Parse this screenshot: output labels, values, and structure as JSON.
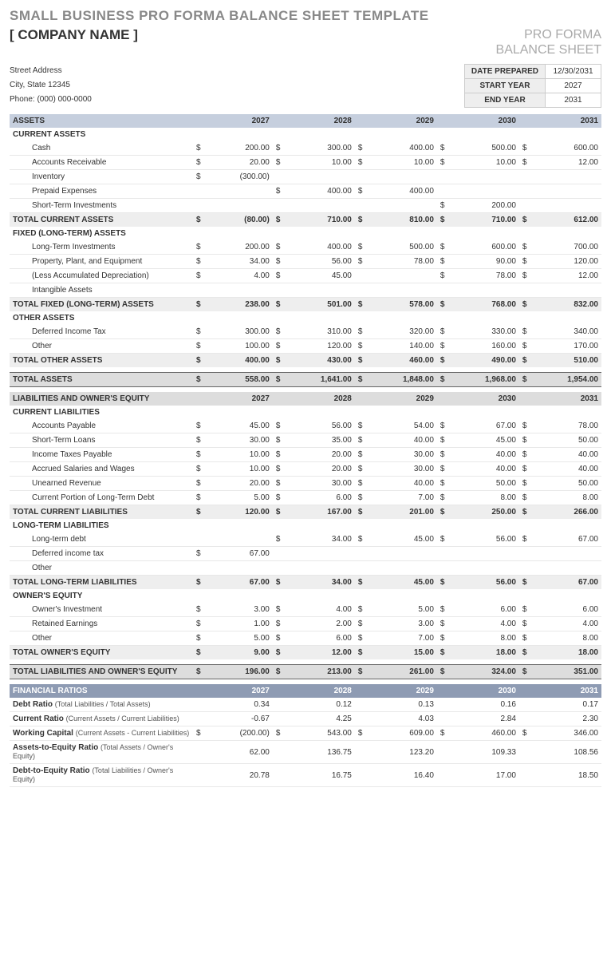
{
  "title": "SMALL BUSINESS PRO FORMA BALANCE SHEET TEMPLATE",
  "company_name": "[ COMPANY NAME ]",
  "proforma_line1": "PRO FORMA",
  "proforma_line2": "BALANCE SHEET",
  "address": {
    "street": "Street Address",
    "city": "City, State  12345",
    "phone": "Phone: (000) 000-0000"
  },
  "meta": {
    "date_prepared_label": "DATE PREPARED",
    "date_prepared": "12/30/2031",
    "start_year_label": "START YEAR",
    "start_year": "2027",
    "end_year_label": "END YEAR",
    "end_year": "2031"
  },
  "years": [
    "2027",
    "2028",
    "2029",
    "2030",
    "2031"
  ],
  "assets_header": "ASSETS",
  "current_assets_header": "CURRENT ASSETS",
  "current_assets": [
    {
      "label": "Cash",
      "v": [
        "200.00",
        "300.00",
        "400.00",
        "500.00",
        "600.00"
      ]
    },
    {
      "label": "Accounts Receivable",
      "v": [
        "20.00",
        "10.00",
        "10.00",
        "10.00",
        "12.00"
      ]
    },
    {
      "label": "Inventory",
      "v": [
        "(300.00)",
        "",
        "",
        "",
        ""
      ]
    },
    {
      "label": "Prepaid Expenses",
      "v": [
        "",
        "400.00",
        "400.00",
        "",
        ""
      ]
    },
    {
      "label": "Short-Term Investments",
      "v": [
        "",
        "",
        "",
        "200.00",
        ""
      ]
    }
  ],
  "total_current_assets": {
    "label": "TOTAL CURRENT ASSETS",
    "v": [
      "(80.00)",
      "710.00",
      "810.00",
      "710.00",
      "612.00"
    ]
  },
  "fixed_assets_header": "FIXED (LONG-TERM) ASSETS",
  "fixed_assets": [
    {
      "label": "Long-Term Investments",
      "v": [
        "200.00",
        "400.00",
        "500.00",
        "600.00",
        "700.00"
      ]
    },
    {
      "label": "Property, Plant, and Equipment",
      "v": [
        "34.00",
        "56.00",
        "78.00",
        "90.00",
        "120.00"
      ]
    },
    {
      "label": "(Less Accumulated Depreciation)",
      "v": [
        "4.00",
        "45.00",
        "",
        "78.00",
        "12.00"
      ]
    },
    {
      "label": "Intangible Assets",
      "v": [
        "",
        "",
        "",
        "",
        ""
      ]
    }
  ],
  "total_fixed_assets": {
    "label": "TOTAL FIXED (LONG-TERM) ASSETS",
    "v": [
      "238.00",
      "501.00",
      "578.00",
      "768.00",
      "832.00"
    ]
  },
  "other_assets_header": "OTHER ASSETS",
  "other_assets": [
    {
      "label": "Deferred Income Tax",
      "v": [
        "300.00",
        "310.00",
        "320.00",
        "330.00",
        "340.00"
      ]
    },
    {
      "label": "Other",
      "v": [
        "100.00",
        "120.00",
        "140.00",
        "160.00",
        "170.00"
      ]
    }
  ],
  "total_other_assets": {
    "label": "TOTAL OTHER ASSETS",
    "v": [
      "400.00",
      "430.00",
      "460.00",
      "490.00",
      "510.00"
    ]
  },
  "total_assets": {
    "label": "TOTAL ASSETS",
    "v": [
      "558.00",
      "1,641.00",
      "1,848.00",
      "1,968.00",
      "1,954.00"
    ]
  },
  "liab_header": "LIABILITIES AND OWNER'S EQUITY",
  "current_liab_header": "CURRENT LIABILITIES",
  "current_liab": [
    {
      "label": "Accounts Payable",
      "v": [
        "45.00",
        "56.00",
        "54.00",
        "67.00",
        "78.00"
      ]
    },
    {
      "label": "Short-Term Loans",
      "v": [
        "30.00",
        "35.00",
        "40.00",
        "45.00",
        "50.00"
      ]
    },
    {
      "label": "Income Taxes Payable",
      "v": [
        "10.00",
        "20.00",
        "30.00",
        "40.00",
        "40.00"
      ]
    },
    {
      "label": "Accrued Salaries and Wages",
      "v": [
        "10.00",
        "20.00",
        "30.00",
        "40.00",
        "40.00"
      ]
    },
    {
      "label": "Unearned Revenue",
      "v": [
        "20.00",
        "30.00",
        "40.00",
        "50.00",
        "50.00"
      ]
    },
    {
      "label": "Current Portion of Long-Term Debt",
      "v": [
        "5.00",
        "6.00",
        "7.00",
        "8.00",
        "8.00"
      ]
    }
  ],
  "total_current_liab": {
    "label": "TOTAL CURRENT LIABILITIES",
    "v": [
      "120.00",
      "167.00",
      "201.00",
      "250.00",
      "266.00"
    ]
  },
  "longterm_liab_header": "LONG-TERM LIABILITIES",
  "longterm_liab": [
    {
      "label": "Long-term debt",
      "v": [
        "",
        "34.00",
        "45.00",
        "56.00",
        "67.00"
      ]
    },
    {
      "label": "Deferred income tax",
      "v": [
        "67.00",
        "",
        "",
        "",
        ""
      ]
    },
    {
      "label": "Other",
      "v": [
        "",
        "",
        "",
        "",
        ""
      ]
    }
  ],
  "total_longterm_liab": {
    "label": "TOTAL LONG-TERM LIABILITIES",
    "v": [
      "67.00",
      "34.00",
      "45.00",
      "56.00",
      "67.00"
    ]
  },
  "equity_header": "OWNER'S EQUITY",
  "equity": [
    {
      "label": "Owner's Investment",
      "v": [
        "3.00",
        "4.00",
        "5.00",
        "6.00",
        "6.00"
      ]
    },
    {
      "label": "Retained Earnings",
      "v": [
        "1.00",
        "2.00",
        "3.00",
        "4.00",
        "4.00"
      ]
    },
    {
      "label": "Other",
      "v": [
        "5.00",
        "6.00",
        "7.00",
        "8.00",
        "8.00"
      ]
    }
  ],
  "total_equity": {
    "label": "TOTAL OWNER'S EQUITY",
    "v": [
      "9.00",
      "12.00",
      "15.00",
      "18.00",
      "18.00"
    ]
  },
  "total_liab_equity": {
    "label": "TOTAL LIABILITIES AND OWNER'S EQUITY",
    "v": [
      "196.00",
      "213.00",
      "261.00",
      "324.00",
      "351.00"
    ]
  },
  "fin_header": "FINANCIAL RATIOS",
  "fin_ratios": [
    {
      "label": "Debt Ratio",
      "sub": "(Total Liabilities / Total Assets)",
      "cur": false,
      "v": [
        "0.34",
        "0.12",
        "0.13",
        "0.16",
        "0.17"
      ]
    },
    {
      "label": "Current Ratio",
      "sub": "(Current Assets / Current Liabilities)",
      "cur": false,
      "v": [
        "-0.67",
        "4.25",
        "4.03",
        "2.84",
        "2.30"
      ]
    },
    {
      "label": "Working Capital",
      "sub": "(Current Assets - Current Liabilities)",
      "cur": true,
      "v": [
        "(200.00)",
        "543.00",
        "609.00",
        "460.00",
        "346.00"
      ]
    },
    {
      "label": "Assets-to-Equity Ratio",
      "sub": "(Total Assets / Owner's Equity)",
      "cur": false,
      "v": [
        "62.00",
        "136.75",
        "123.20",
        "109.33",
        "108.56"
      ]
    },
    {
      "label": "Debt-to-Equity Ratio",
      "sub": "(Total Liabilities / Owner's Equity)",
      "cur": false,
      "v": [
        "20.78",
        "16.75",
        "16.40",
        "17.00",
        "18.50"
      ]
    }
  ]
}
